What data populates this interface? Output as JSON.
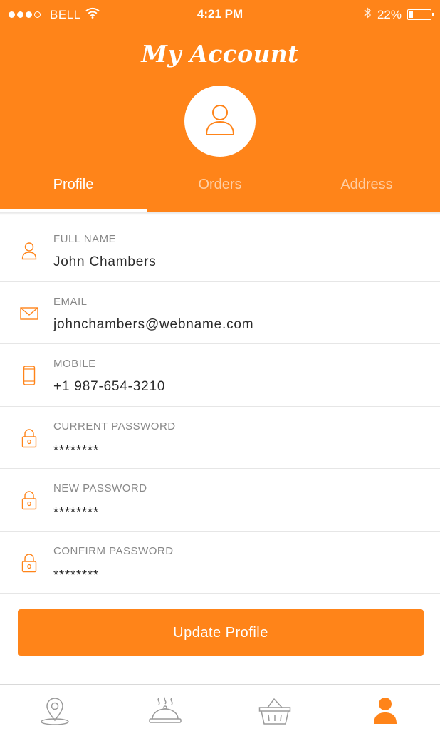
{
  "status_bar": {
    "carrier": "BELL",
    "time": "4:21 PM",
    "battery_percent": "22%",
    "battery_level": 0.22,
    "icons": [
      "signal-dots-icon",
      "wifi-icon",
      "bluetooth-icon",
      "battery-icon"
    ]
  },
  "header": {
    "title": "My Account",
    "avatar_icon": "user-icon"
  },
  "tabs": [
    {
      "label": "Profile",
      "active": true
    },
    {
      "label": "Orders",
      "active": false
    },
    {
      "label": "Address",
      "active": false
    }
  ],
  "form": {
    "fields": [
      {
        "label": "FULL NAME",
        "value": "John Chambers",
        "icon": "user-icon"
      },
      {
        "label": "EMAIL",
        "value": "johnchambers@webname.com",
        "icon": "envelope-icon"
      },
      {
        "label": "MOBILE",
        "value": "+1 987-654-3210",
        "icon": "phone-icon"
      },
      {
        "label": "CURRENT PASSWORD",
        "value": "********",
        "icon": "lock-icon"
      },
      {
        "label": "NEW PASSWORD",
        "value": "********",
        "icon": "lock-icon"
      },
      {
        "label": "CONFIRM PASSWORD",
        "value": "********",
        "icon": "lock-icon"
      }
    ],
    "submit_label": "Update Profile"
  },
  "bottom_nav": {
    "items": [
      {
        "icon": "location-pin-icon",
        "active": false
      },
      {
        "icon": "food-cloche-icon",
        "active": false
      },
      {
        "icon": "basket-icon",
        "active": false
      },
      {
        "icon": "user-icon",
        "active": true
      }
    ]
  },
  "colors": {
    "accent": "#ff8419",
    "icon_inactive": "#9a9a9a",
    "label": "#888888",
    "value": "#2b2b2b"
  }
}
